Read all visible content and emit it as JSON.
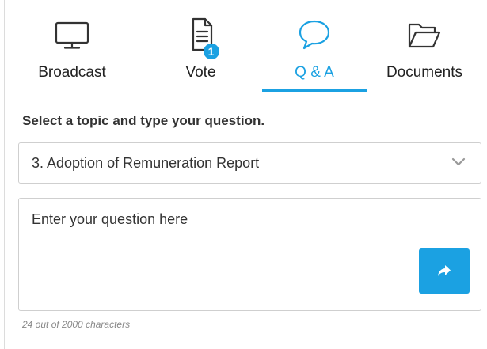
{
  "tabs": [
    {
      "label": "Broadcast",
      "icon": "monitor-icon",
      "active": false
    },
    {
      "label": "Vote",
      "icon": "document-icon",
      "active": false,
      "badge": "1"
    },
    {
      "label": "Q & A",
      "icon": "speech-bubble-icon",
      "active": true
    },
    {
      "label": "Documents",
      "icon": "folder-icon",
      "active": false
    }
  ],
  "qa": {
    "heading": "Select a topic and type your question.",
    "topic_selected": "3. Adoption of Remuneration Report",
    "question_placeholder": "Enter your question here",
    "char_counter": "24 out of 2000 characters"
  },
  "colors": {
    "accent": "#1ba1e2",
    "text": "#222222",
    "border": "#cfcfcf",
    "muted": "#888888"
  }
}
